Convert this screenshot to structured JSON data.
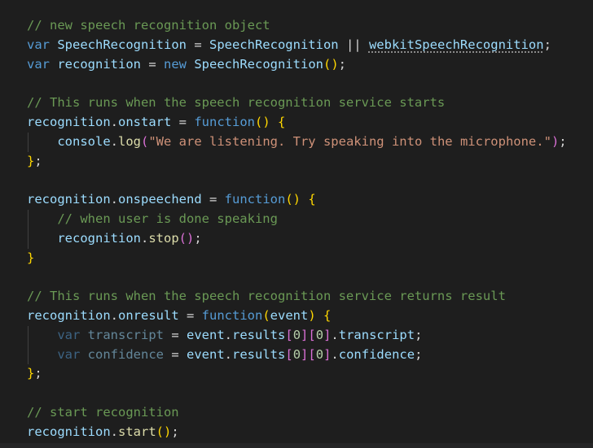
{
  "editor": {
    "language": "javascript",
    "colors": {
      "background": "#1e1e1e",
      "comment": "#6a9955",
      "keyword": "#569cd6",
      "variable": "#9cdcfe",
      "function": "#dcdcaa",
      "string": "#ce9178",
      "bracket1": "#ffd700",
      "bracket2": "#da70d6"
    },
    "lines": [
      {
        "guide": false,
        "tokens": [
          [
            "// new speech recognition object",
            "c"
          ]
        ]
      },
      {
        "guide": false,
        "tokens": [
          [
            "var",
            "k"
          ],
          [
            " ",
            "p"
          ],
          [
            "SpeechRecognition",
            "v"
          ],
          [
            " = ",
            "p"
          ],
          [
            "SpeechRecognition",
            "v"
          ],
          [
            " || ",
            "p"
          ],
          [
            "webkitSpeechRecognition",
            "v hint"
          ],
          [
            ";",
            "p"
          ]
        ]
      },
      {
        "guide": false,
        "tokens": [
          [
            "var",
            "k"
          ],
          [
            " ",
            "p"
          ],
          [
            "recognition",
            "v"
          ],
          [
            " = ",
            "p"
          ],
          [
            "new",
            "k"
          ],
          [
            " ",
            "p"
          ],
          [
            "SpeechRecognition",
            "v"
          ],
          [
            "()",
            "b1"
          ],
          [
            ";",
            "p"
          ]
        ]
      },
      {
        "guide": false,
        "tokens": []
      },
      {
        "guide": false,
        "tokens": [
          [
            "// This runs when the speech recognition service starts",
            "c"
          ]
        ]
      },
      {
        "guide": false,
        "tokens": [
          [
            "recognition",
            "v"
          ],
          [
            ".",
            "p"
          ],
          [
            "onstart",
            "v"
          ],
          [
            " = ",
            "p"
          ],
          [
            "function",
            "k"
          ],
          [
            "()",
            "b1"
          ],
          [
            " ",
            "p"
          ],
          [
            "{",
            "b1"
          ]
        ]
      },
      {
        "guide": true,
        "tokens": [
          [
            "    ",
            "p"
          ],
          [
            "console",
            "v"
          ],
          [
            ".",
            "p"
          ],
          [
            "log",
            "f"
          ],
          [
            "(",
            "b2"
          ],
          [
            "\"We are listening. Try speaking into the microphone.\"",
            "s"
          ],
          [
            ")",
            "b2"
          ],
          [
            ";",
            "p"
          ]
        ]
      },
      {
        "guide": false,
        "tokens": [
          [
            "}",
            "b1"
          ],
          [
            ";",
            "p"
          ]
        ]
      },
      {
        "guide": false,
        "tokens": []
      },
      {
        "guide": false,
        "tokens": [
          [
            "recognition",
            "v"
          ],
          [
            ".",
            "p"
          ],
          [
            "onspeechend",
            "v"
          ],
          [
            " = ",
            "p"
          ],
          [
            "function",
            "k"
          ],
          [
            "()",
            "b1"
          ],
          [
            " ",
            "p"
          ],
          [
            "{",
            "b1"
          ]
        ]
      },
      {
        "guide": true,
        "tokens": [
          [
            "    ",
            "p"
          ],
          [
            "// when user is done speaking",
            "c"
          ]
        ]
      },
      {
        "guide": true,
        "tokens": [
          [
            "    ",
            "p"
          ],
          [
            "recognition",
            "v"
          ],
          [
            ".",
            "p"
          ],
          [
            "stop",
            "f"
          ],
          [
            "()",
            "b2"
          ],
          [
            ";",
            "p"
          ]
        ]
      },
      {
        "guide": false,
        "tokens": [
          [
            "}",
            "b1"
          ]
        ]
      },
      {
        "guide": false,
        "tokens": []
      },
      {
        "guide": false,
        "tokens": [
          [
            "// This runs when the speech recognition service returns result",
            "c"
          ]
        ]
      },
      {
        "guide": false,
        "tokens": [
          [
            "recognition",
            "v"
          ],
          [
            ".",
            "p"
          ],
          [
            "onresult",
            "v"
          ],
          [
            " = ",
            "p"
          ],
          [
            "function",
            "k"
          ],
          [
            "(",
            "b1"
          ],
          [
            "event",
            "v"
          ],
          [
            ")",
            "b1"
          ],
          [
            " ",
            "p"
          ],
          [
            "{",
            "b1"
          ]
        ]
      },
      {
        "guide": true,
        "tokens": [
          [
            "    ",
            "p"
          ],
          [
            "var",
            "dk"
          ],
          [
            " ",
            "p"
          ],
          [
            "transcript",
            "d"
          ],
          [
            " = ",
            "p"
          ],
          [
            "event",
            "v"
          ],
          [
            ".",
            "p"
          ],
          [
            "results",
            "v"
          ],
          [
            "[",
            "b2"
          ],
          [
            "0",
            "n"
          ],
          [
            "]",
            "b2"
          ],
          [
            "[",
            "b2"
          ],
          [
            "0",
            "n"
          ],
          [
            "]",
            "b2"
          ],
          [
            ".",
            "p"
          ],
          [
            "transcript",
            "v"
          ],
          [
            ";",
            "p"
          ]
        ]
      },
      {
        "guide": true,
        "tokens": [
          [
            "    ",
            "p"
          ],
          [
            "var",
            "dk"
          ],
          [
            " ",
            "p"
          ],
          [
            "confidence",
            "d"
          ],
          [
            " = ",
            "p"
          ],
          [
            "event",
            "v"
          ],
          [
            ".",
            "p"
          ],
          [
            "results",
            "v"
          ],
          [
            "[",
            "b2"
          ],
          [
            "0",
            "n"
          ],
          [
            "]",
            "b2"
          ],
          [
            "[",
            "b2"
          ],
          [
            "0",
            "n"
          ],
          [
            "]",
            "b2"
          ],
          [
            ".",
            "p"
          ],
          [
            "confidence",
            "v"
          ],
          [
            ";",
            "p"
          ]
        ]
      },
      {
        "guide": false,
        "tokens": [
          [
            "}",
            "b1"
          ],
          [
            ";",
            "p"
          ]
        ]
      },
      {
        "guide": false,
        "tokens": []
      },
      {
        "guide": false,
        "tokens": [
          [
            "// start recognition",
            "c"
          ]
        ]
      },
      {
        "guide": false,
        "tokens": [
          [
            "recognition",
            "v"
          ],
          [
            ".",
            "p"
          ],
          [
            "start",
            "f"
          ],
          [
            "()",
            "b1"
          ],
          [
            ";",
            "p"
          ]
        ]
      }
    ]
  }
}
